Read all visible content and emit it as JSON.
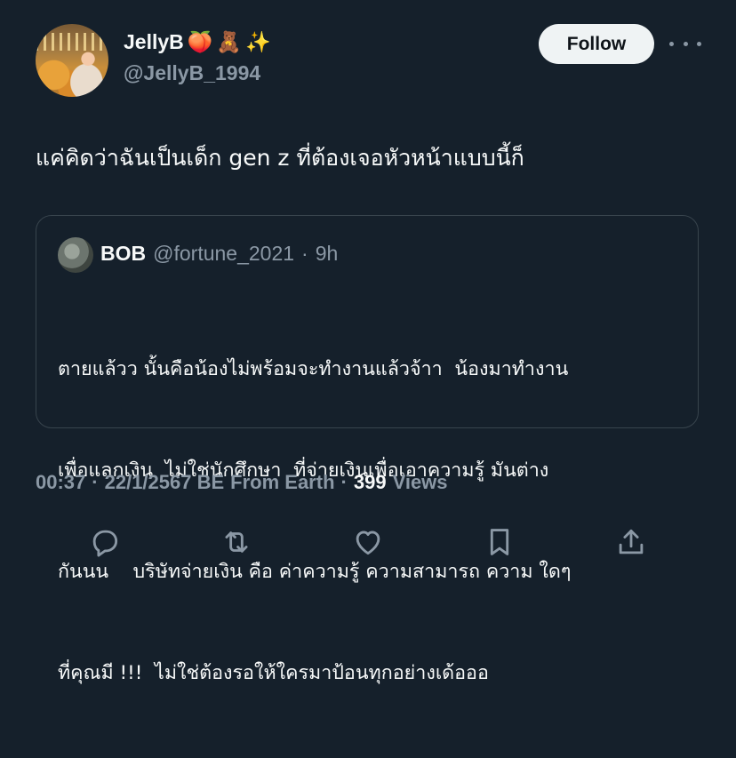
{
  "author": {
    "display_name": "JellyB",
    "emojis": [
      "🍑",
      "🧸",
      "✨"
    ],
    "handle": "@JellyB_1994"
  },
  "header": {
    "follow_label": "Follow",
    "more_icon": "more-horizontal-icon"
  },
  "tweet": {
    "text": "แค่คิดว่าฉันเป็นเด็ก gen z ที่ต้องเจอหัวหน้าแบบนี้ก็"
  },
  "quote": {
    "name": "BOB",
    "handle": "@fortune_2021",
    "separator": "·",
    "time": "9h",
    "lines": [
      "ตายแล้วว นั้นคือน้องไม่พร้อมจะทำงานแล้วจ้าา  น้องมาทำงาน",
      "เพื่อแลกเงิน  ไม่ใช่นักศึกษา  ที่จ่ายเงินเพื่อเอาความรู้ มันต่าง",
      "กันนน    บริษัทจ่ายเงิน คือ ค่าความรู้ ความสามารถ ความ ใดๆ",
      "ที่คุณมี !!!  ไม่ใช่ต้องรอให้ใครมาป้อนทุกอย่างเด้อออ"
    ]
  },
  "meta": {
    "time": "00:37",
    "sep1": "·",
    "date": "22/1/2567 BE",
    "source": "From Earth",
    "sep2": "·",
    "views_count": "399",
    "views_label": "Views"
  },
  "actions": [
    "reply-icon",
    "retweet-icon",
    "like-icon",
    "bookmark-icon",
    "share-icon"
  ],
  "colors": {
    "background": "#15202b",
    "text": "#f7f9f9",
    "secondary": "#8b98a5",
    "border": "#38444d",
    "button_bg": "#eff3f4"
  }
}
